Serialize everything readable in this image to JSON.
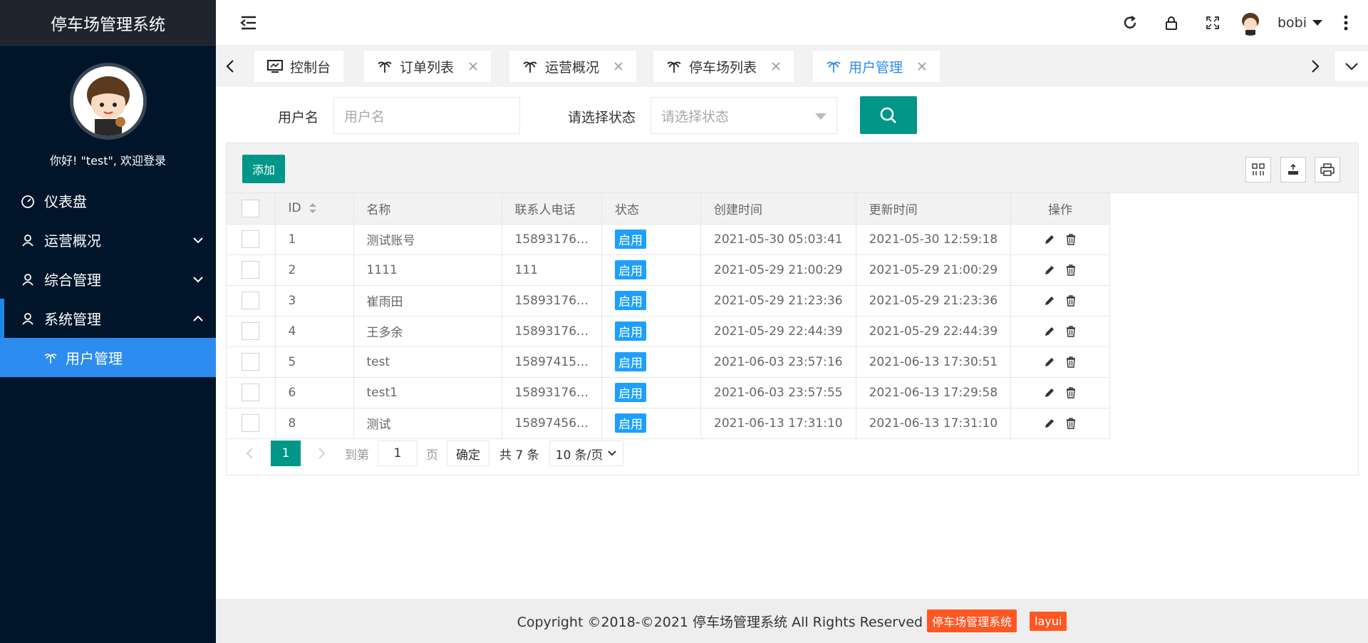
{
  "app": {
    "title": "停车场管理系统"
  },
  "sidebar": {
    "welcome": "你好!  \"test\", 欢迎登录",
    "items": [
      {
        "label": "仪表盘",
        "icon": "dashboard-icon"
      },
      {
        "label": "运营概况",
        "icon": "user-icon"
      },
      {
        "label": "综合管理",
        "icon": "user-icon"
      },
      {
        "label": "系统管理",
        "icon": "user-icon"
      }
    ],
    "subitem": {
      "label": "用户管理",
      "icon": "palm-icon"
    }
  },
  "header": {
    "username": "bobi"
  },
  "tabs": [
    {
      "label": "控制台",
      "icon": "monitor-icon"
    },
    {
      "label": "订单列表",
      "icon": "palm-icon"
    },
    {
      "label": "运营概况",
      "icon": "palm-icon"
    },
    {
      "label": "停车场列表",
      "icon": "palm-icon"
    },
    {
      "label": "用户管理",
      "icon": "palm-icon",
      "active": true
    }
  ],
  "search": {
    "username_label": "用户名",
    "username_placeholder": "用户名",
    "status_label": "请选择状态",
    "status_placeholder": "请选择状态"
  },
  "toolbar": {
    "add_label": "添加"
  },
  "table": {
    "headers": [
      "ID",
      "名称",
      "联系人电话",
      "状态",
      "创建时间",
      "更新时间",
      "操作"
    ],
    "rows": [
      {
        "id": "1",
        "name": "测试账号",
        "phone": "15893176…",
        "status": "启用",
        "created": "2021-05-30 05:03:41",
        "updated": "2021-05-30 12:59:18"
      },
      {
        "id": "2",
        "name": "1111",
        "phone": "111",
        "status": "启用",
        "created": "2021-05-29 21:00:29",
        "updated": "2021-05-29 21:00:29"
      },
      {
        "id": "3",
        "name": "崔雨田",
        "phone": "15893176…",
        "status": "启用",
        "created": "2021-05-29 21:23:36",
        "updated": "2021-05-29 21:23:36"
      },
      {
        "id": "4",
        "name": "王多余",
        "phone": "15893176…",
        "status": "启用",
        "created": "2021-05-29 22:44:39",
        "updated": "2021-05-29 22:44:39"
      },
      {
        "id": "5",
        "name": "test",
        "phone": "15897415…",
        "status": "启用",
        "created": "2021-06-03 23:57:16",
        "updated": "2021-06-13 17:30:51"
      },
      {
        "id": "6",
        "name": "test1",
        "phone": "15893176…",
        "status": "启用",
        "created": "2021-06-03 23:57:55",
        "updated": "2021-06-13 17:29:58"
      },
      {
        "id": "8",
        "name": "测试",
        "phone": "15897456…",
        "status": "启用",
        "created": "2021-06-13 17:31:10",
        "updated": "2021-06-13 17:31:10"
      }
    ]
  },
  "pager": {
    "current": "1",
    "skip_label": "到第",
    "page_input": "1",
    "page_unit": "页",
    "ok_label": "确定",
    "total": "共 7 条",
    "page_size": "10 条/页"
  },
  "footer": {
    "copyright": "Copyright ©2018-©2021 停车场管理系统 All Rights Reserved",
    "badge1": "停车场管理系统",
    "badge2": "layui"
  },
  "colors": {
    "sidebar_bg": "#001529",
    "accent_blue": "#2d8cf0",
    "teal": "#009688",
    "orange": "#ff5722",
    "badge_blue": "#1e9fff"
  }
}
